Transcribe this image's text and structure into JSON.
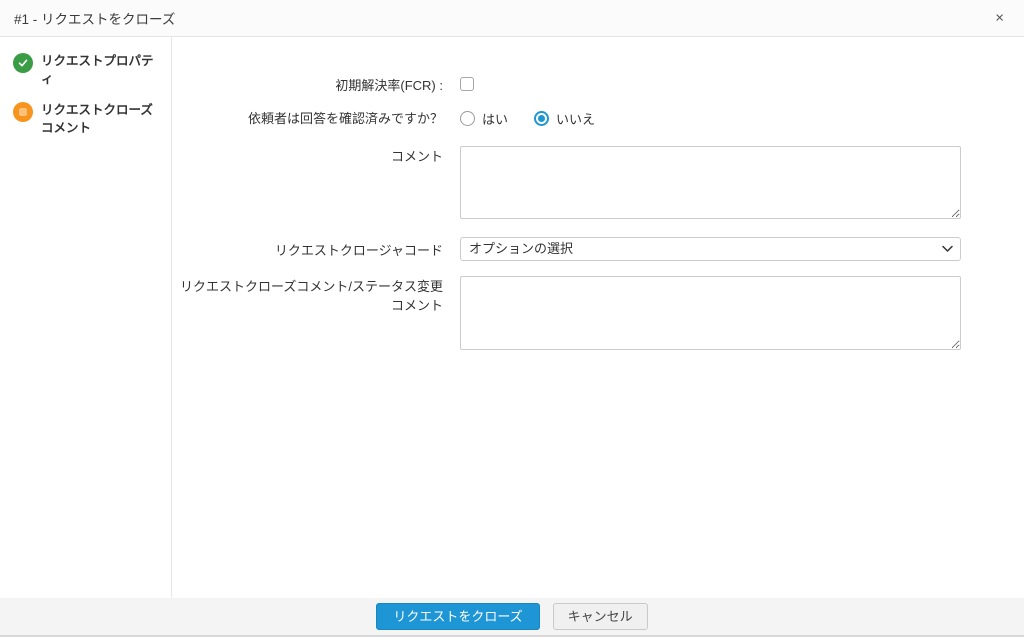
{
  "dialog": {
    "title": "#1 - リクエストをクローズ",
    "close_icon": "×"
  },
  "sidebar": {
    "items": [
      {
        "label": "リクエストプロパティ",
        "state": "completed",
        "icon": "check-icon"
      },
      {
        "label": "リクエストクローズコメント",
        "state": "current",
        "icon": "current-step-icon"
      }
    ]
  },
  "form": {
    "fcr": {
      "label": "初期解決率(FCR) :",
      "checked": false
    },
    "requester_confirm": {
      "label": "依頼者は回答を確認済みですか？",
      "options": [
        {
          "label": "はい",
          "selected": false
        },
        {
          "label": "いいえ",
          "selected": true
        }
      ]
    },
    "comment": {
      "label": "コメント",
      "value": ""
    },
    "closure_code": {
      "label": "リクエストクロージャコード",
      "selected_option": "オプションの選択"
    },
    "close_comment": {
      "label": "リクエストクローズコメント/ステータス変更コメント",
      "value": ""
    }
  },
  "footer": {
    "close_label": "リクエストをクローズ",
    "cancel_label": "キャンセル"
  },
  "colors": {
    "accent_blue": "#1e95d4",
    "completed_green": "#3a9d46",
    "current_orange": "#f7941d",
    "footer_bg": "#f4f4f4",
    "border": "#cccccc"
  }
}
